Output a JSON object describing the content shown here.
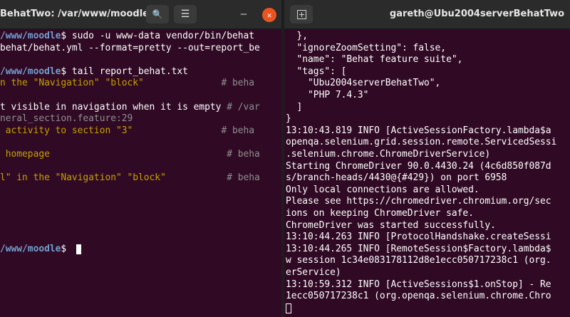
{
  "left": {
    "title": "BehatTwo: /var/www/moodle",
    "icons": {
      "search": "🔍",
      "menu": "☰",
      "minimize": "—",
      "close": "✕"
    },
    "lines": [
      {
        "segments": [
          {
            "t": "/www/moodle",
            "c": "b"
          },
          {
            "t": "$ sudo -u www-data vendor/bin/behat",
            "c": "w"
          }
        ]
      },
      {
        "segments": [
          {
            "t": "behat/behat.yml --format=pretty --out=report_be",
            "c": "w"
          }
        ]
      },
      {
        "segments": [
          {
            "t": "",
            "c": "w"
          }
        ]
      },
      {
        "segments": [
          {
            "t": "/www/moodle",
            "c": "b"
          },
          {
            "t": "$ tail report_behat.txt",
            "c": "w"
          }
        ]
      },
      {
        "segments": [
          {
            "t": "n the \"Navigation\" \"block\"",
            "c": "y"
          },
          {
            "t": "              # beha",
            "c": "d"
          }
        ]
      },
      {
        "segments": [
          {
            "t": "",
            "c": "w"
          }
        ]
      },
      {
        "segments": [
          {
            "t": "t visible in navigation when it is empty",
            "c": "w"
          },
          {
            "t": " # /var",
            "c": "d"
          }
        ]
      },
      {
        "segments": [
          {
            "t": "neral_section.feature:29",
            "c": "d"
          }
        ]
      },
      {
        "segments": [
          {
            "t": " activity to section \"3\"",
            "c": "y"
          },
          {
            "t": "                # beha",
            "c": "d"
          }
        ]
      },
      {
        "segments": [
          {
            "t": "",
            "c": "w"
          }
        ]
      },
      {
        "segments": [
          {
            "t": " homepage",
            "c": "y"
          },
          {
            "t": "                                # beha",
            "c": "d"
          }
        ]
      },
      {
        "segments": [
          {
            "t": "",
            "c": "w"
          }
        ]
      },
      {
        "segments": [
          {
            "t": "l\" in the \"Navigation\" \"block\"",
            "c": "y"
          },
          {
            "t": "           # beha",
            "c": "d"
          }
        ]
      },
      {
        "segments": [
          {
            "t": "",
            "c": "w"
          }
        ]
      },
      {
        "segments": [
          {
            "t": "",
            "c": "w"
          }
        ]
      },
      {
        "segments": [
          {
            "t": "",
            "c": "w"
          }
        ]
      },
      {
        "segments": [
          {
            "t": "",
            "c": "w"
          }
        ]
      },
      {
        "segments": [
          {
            "t": "",
            "c": "w"
          }
        ]
      },
      {
        "segments": [
          {
            "t": "/www/moodle",
            "c": "b"
          },
          {
            "t": "$ ",
            "c": "w"
          }
        ]
      }
    ]
  },
  "right": {
    "title": "gareth@Ubu2004serverBehatTwo",
    "lines": [
      "  },",
      "  \"ignoreZoomSetting\": false,",
      "  \"name\": \"Behat feature suite\",",
      "  \"tags\": [",
      "    \"Ubu2004serverBehatTwo\",",
      "    \"PHP 7.4.3\"",
      "  ]",
      "}",
      "13:10:43.819 INFO [ActiveSessionFactory.lambda$a",
      "openqa.selenium.grid.session.remote.ServicedSessi",
      ".selenium.chrome.ChromeDriverService)",
      "Starting ChromeDriver 90.0.4430.24 (4c6d850f087d",
      "s/branch-heads/4430@{#429}) on port 6958",
      "Only local connections are allowed.",
      "Please see https://chromedriver.chromium.org/sec",
      "ions on keeping ChromeDriver safe.",
      "ChromeDriver was started successfully.",
      "13:10:44.263 INFO [ProtocolHandshake.createSessi",
      "13:10:44.265 INFO [RemoteSession$Factory.lambda$",
      "w session 1c34e083178112d8e1ecc050717238c1 (org.",
      "erService)",
      "13:10:59.312 INFO [ActiveSessions$1.onStop] - Re",
      "1ecc050717238c1 (org.openqa.selenium.chrome.Chro"
    ]
  }
}
